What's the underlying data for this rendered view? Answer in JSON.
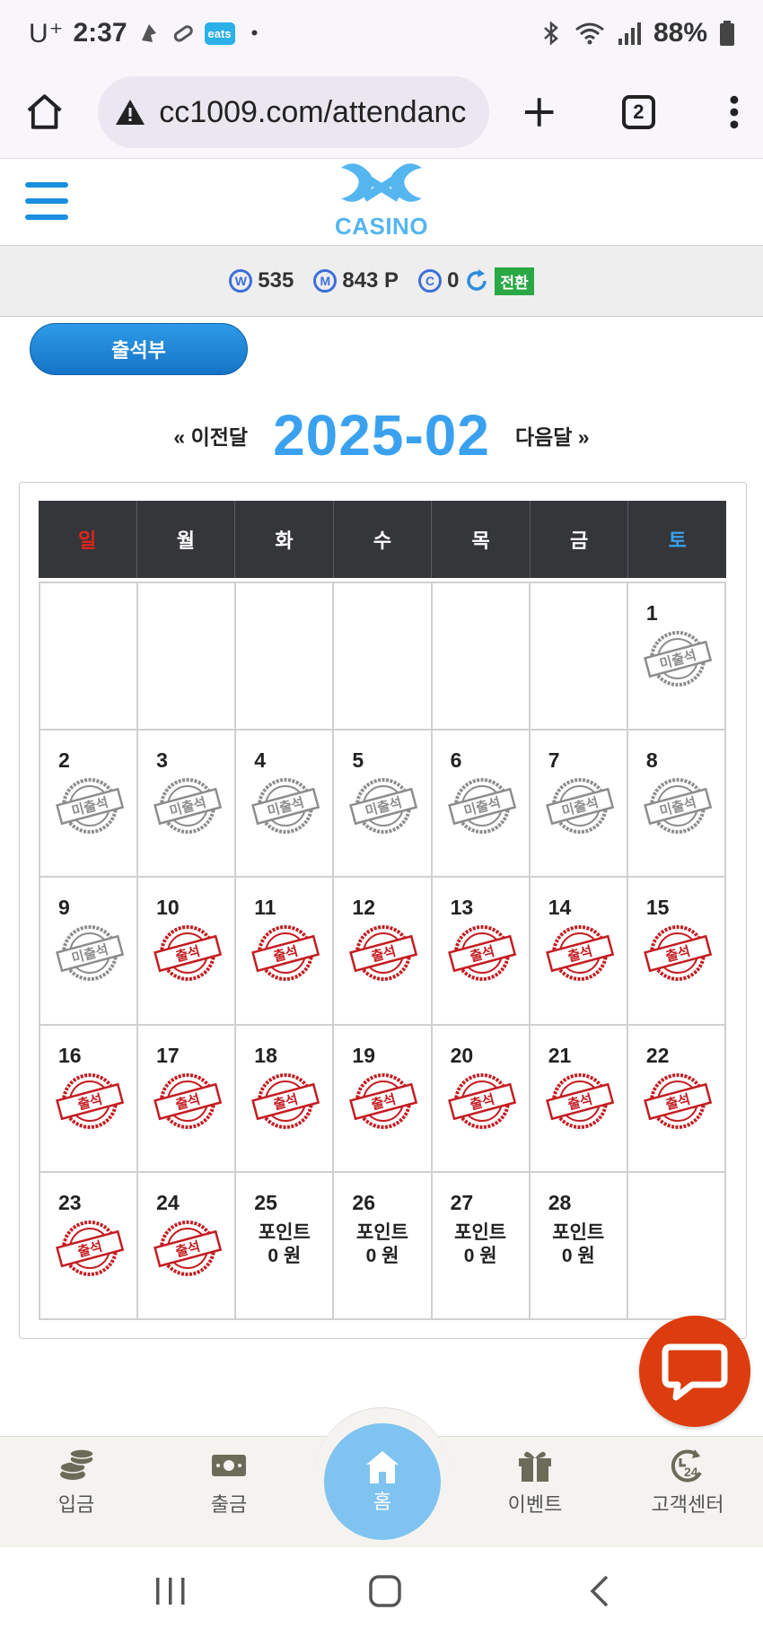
{
  "status_bar": {
    "carrier": "U⁺",
    "time": "2:37",
    "app_badge": "eats",
    "dot": "•",
    "battery": "88%"
  },
  "browser": {
    "url": "cc1009.com/attendanc",
    "tab_count": "2"
  },
  "site": {
    "logo_text": "CASINO"
  },
  "balance": {
    "won": "535",
    "won_icon": "W",
    "mileage": "843 P",
    "mileage_icon": "M",
    "coin": "0",
    "coin_icon": "C",
    "switch_label": "전환"
  },
  "attendance_button": "출석부",
  "month_nav": {
    "prev": "« 이전달",
    "title": "2025-02",
    "next": "다음달 »"
  },
  "weekdays": [
    "일",
    "월",
    "화",
    "수",
    "목",
    "금",
    "토"
  ],
  "colors": {
    "sunday": "#e0241b",
    "saturday": "#3aa1f0",
    "attended": "#c41d22",
    "absent": "#8d8d8d"
  },
  "stamp_labels": {
    "attended": "출석",
    "absent": "미출석"
  },
  "points_text": {
    "line1": "포인트",
    "line2": "0 원"
  },
  "calendar": [
    {
      "day": "",
      "status": "none"
    },
    {
      "day": "",
      "status": "none"
    },
    {
      "day": "",
      "status": "none"
    },
    {
      "day": "",
      "status": "none"
    },
    {
      "day": "",
      "status": "none"
    },
    {
      "day": "",
      "status": "none"
    },
    {
      "day": "1",
      "status": "absent"
    },
    {
      "day": "2",
      "status": "absent"
    },
    {
      "day": "3",
      "status": "absent"
    },
    {
      "day": "4",
      "status": "absent"
    },
    {
      "day": "5",
      "status": "absent"
    },
    {
      "day": "6",
      "status": "absent"
    },
    {
      "day": "7",
      "status": "absent"
    },
    {
      "day": "8",
      "status": "absent"
    },
    {
      "day": "9",
      "status": "absent"
    },
    {
      "day": "10",
      "status": "attended"
    },
    {
      "day": "11",
      "status": "attended"
    },
    {
      "day": "12",
      "status": "attended"
    },
    {
      "day": "13",
      "status": "attended"
    },
    {
      "day": "14",
      "status": "attended"
    },
    {
      "day": "15",
      "status": "attended"
    },
    {
      "day": "16",
      "status": "attended"
    },
    {
      "day": "17",
      "status": "attended"
    },
    {
      "day": "18",
      "status": "attended"
    },
    {
      "day": "19",
      "status": "attended"
    },
    {
      "day": "20",
      "status": "attended"
    },
    {
      "day": "21",
      "status": "attended"
    },
    {
      "day": "22",
      "status": "attended"
    },
    {
      "day": "23",
      "status": "attended"
    },
    {
      "day": "24",
      "status": "attended"
    },
    {
      "day": "25",
      "status": "points"
    },
    {
      "day": "26",
      "status": "points"
    },
    {
      "day": "27",
      "status": "points"
    },
    {
      "day": "28",
      "status": "points"
    },
    {
      "day": "",
      "status": "none"
    }
  ],
  "bottom_nav": {
    "deposit": "입금",
    "withdraw": "출금",
    "home": "홈",
    "event": "이벤트",
    "support": "고객센터"
  }
}
